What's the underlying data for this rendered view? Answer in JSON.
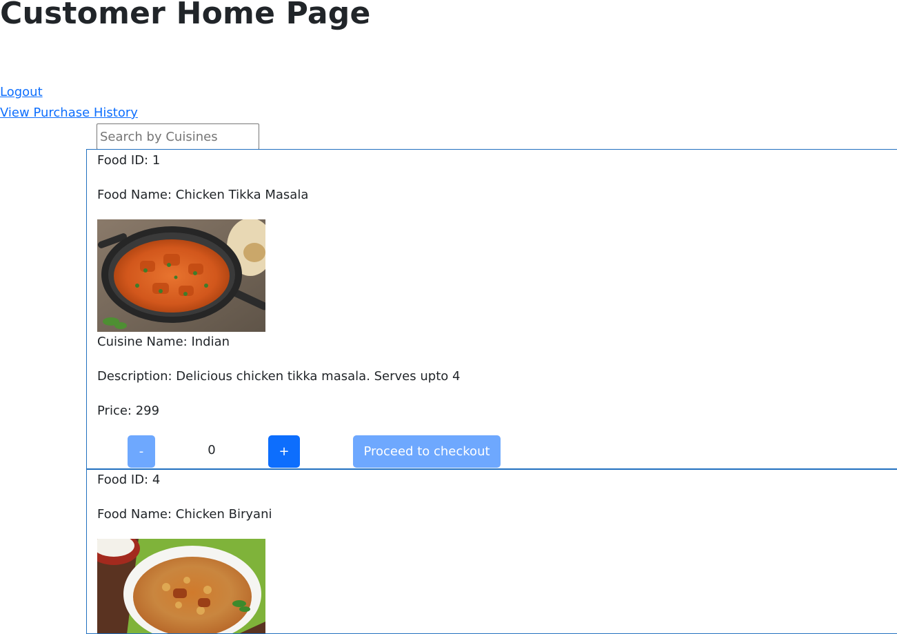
{
  "header": {
    "title": "Customer Home Page"
  },
  "nav": {
    "logout_label": "Logout",
    "history_label": "View Purchase History"
  },
  "search": {
    "placeholder": "Search by Cuisines",
    "value": ""
  },
  "foods": [
    {
      "id_text": "Food ID: 1",
      "name_text": "Food Name: Chicken Tikka Masala",
      "image_alt": "chicken-tikka-masala-photo",
      "cuisine_text": "Cuisine Name: Indian",
      "description_text": "Description: Delicious chicken tikka masala. Serves upto 4",
      "price_text": "Price: 299",
      "quantity": "0",
      "minus_label": "-",
      "plus_label": "+",
      "checkout_label": "Proceed to checkout"
    },
    {
      "id_text": "Food ID: 4",
      "name_text": "Food Name: Chicken Biryani",
      "image_alt": "chicken-biryani-photo"
    }
  ],
  "colors": {
    "link": "#0d6efd",
    "primary": "#0d6efd",
    "primary_disabled": "#6ea8fe",
    "card_border": "#1f6fbf",
    "text": "#212529"
  }
}
